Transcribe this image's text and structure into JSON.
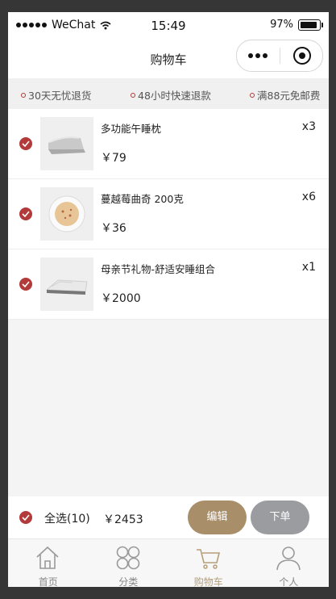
{
  "status_bar": {
    "carrier": "WeChat",
    "time": "15:49",
    "battery": "97%"
  },
  "navbar": {
    "title": "购物车"
  },
  "promos": [
    "30天无忧退货",
    "48小时快速退款",
    "满88元免邮费"
  ],
  "cart": {
    "items": [
      {
        "name": "多功能午睡枕",
        "price": "￥79",
        "qty": "x3",
        "image_icon": "pillow-icon"
      },
      {
        "name": "蔓越莓曲奇 200克",
        "price": "￥36",
        "qty": "x6",
        "image_icon": "cookie-icon"
      },
      {
        "name": "母亲节礼物-舒适安睡组合",
        "price": "￥2000",
        "qty": "x1",
        "image_icon": "bedding-icon"
      }
    ]
  },
  "footer": {
    "select_all": "全选(10)",
    "total": "￥2453",
    "edit": "编辑",
    "order": "下单"
  },
  "tabs": [
    {
      "label": "首页",
      "icon": "home-icon"
    },
    {
      "label": "分类",
      "icon": "category-icon"
    },
    {
      "label": "购物车",
      "icon": "cart-icon",
      "active": true
    },
    {
      "label": "个人",
      "icon": "person-icon"
    }
  ],
  "colors": {
    "check": "#b33a3a",
    "edit_button": "#a88f6a",
    "order_button": "#9a9ca0",
    "active_tab": "#b69f78"
  }
}
